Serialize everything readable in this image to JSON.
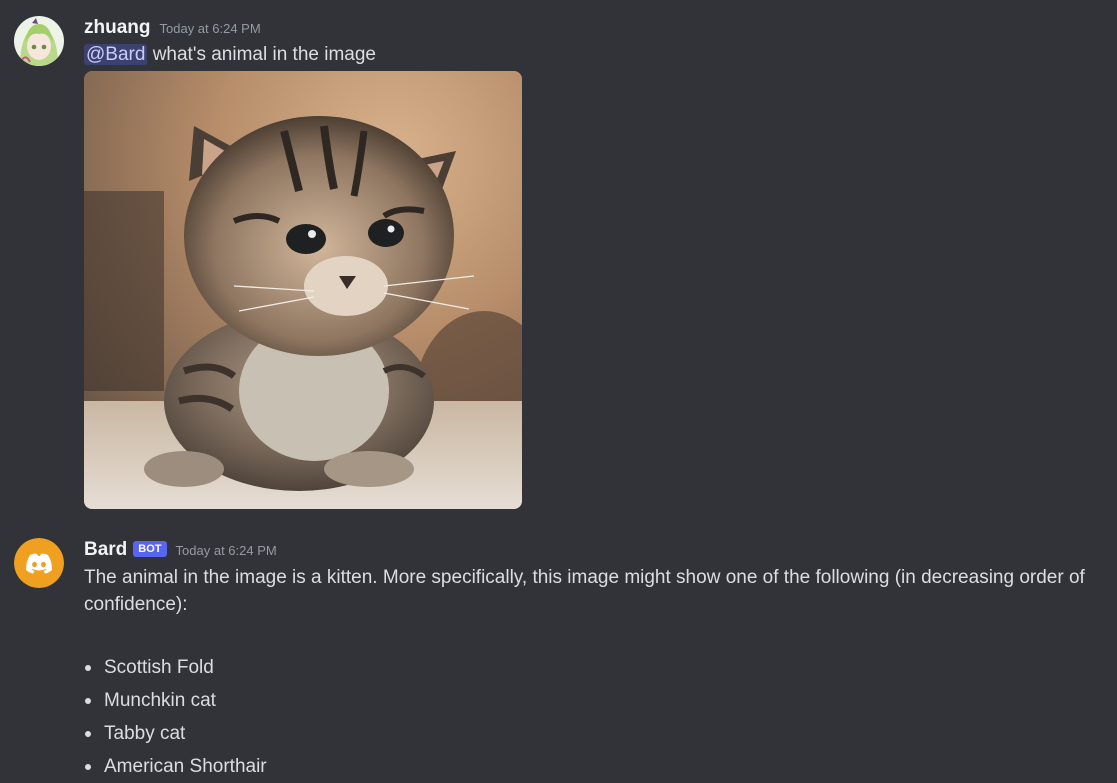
{
  "messages": [
    {
      "author": "zhuang",
      "timestamp": "Today at 6:24 PM",
      "mention": "@Bard",
      "text": " what's animal in the image",
      "attachment": {
        "alt": "kitten photo"
      }
    },
    {
      "author": "Bard",
      "bot_tag": "BOT",
      "timestamp": "Today at 6:24 PM",
      "text": "The animal in the image is a kitten. More specifically, this image might show one of the following (in decreasing order of confidence):",
      "list": [
        "Scottish Fold",
        "Munchkin cat",
        "Tabby cat",
        "American Shorthair"
      ]
    }
  ],
  "colors": {
    "background": "#313338",
    "text": "#dbdee1",
    "username": "#f2f3f5",
    "timestamp": "#949ba4",
    "bot_tag": "#5865f2",
    "bard_avatar": "#f0a020"
  },
  "icons": {
    "user_avatar": "anime-avatar-icon",
    "bot_avatar": "discord-logo-icon"
  }
}
